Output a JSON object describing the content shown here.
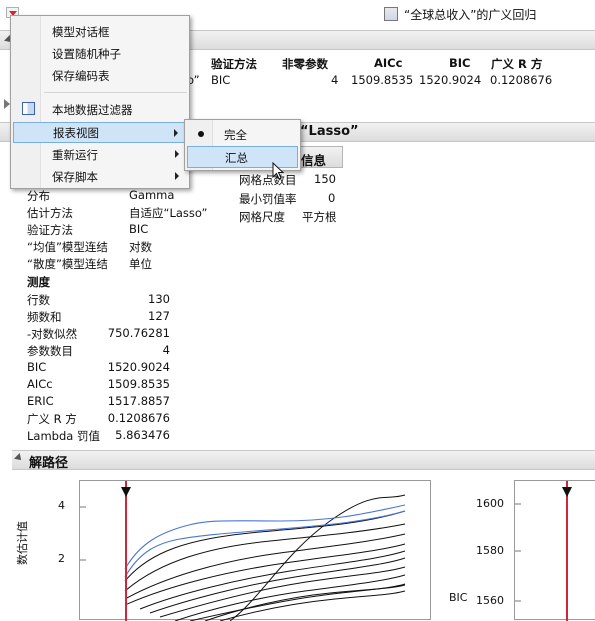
{
  "window": {
    "title": "“全球总收入”的广义回归"
  },
  "summary_table": {
    "headers": [
      "验证方法",
      "非零参数",
      "AICc",
      "BIC",
      "广义 R 方"
    ],
    "partial_cell": "o”",
    "row": [
      "BIC",
      "4",
      "1509.8535",
      "1520.9024",
      "0.1208676"
    ]
  },
  "sections": {
    "lasso_title": "“Lasso”",
    "info_label": "信息",
    "path_title": "解路径"
  },
  "model_info_left": [
    {
      "label": "分布",
      "value": "Gamma"
    },
    {
      "label": "估计方法",
      "value": "自适应“Lasso”"
    },
    {
      "label": "验证方法",
      "value": "BIC"
    },
    {
      "label": "“均值”模型连结",
      "value": "对数"
    },
    {
      "label": "“散度”模型连结",
      "value": "单位"
    }
  ],
  "model_info_right": [
    {
      "label": "网格点数目",
      "value": "150"
    },
    {
      "label": "最小罚值率",
      "value": "0"
    },
    {
      "label": "网格尺度",
      "value": "平方根"
    }
  ],
  "measures": {
    "title": "测度",
    "rows": [
      {
        "label": "行数",
        "value": "130"
      },
      {
        "label": "频数和",
        "value": "127"
      },
      {
        "label": "-对数似然",
        "value": "750.76281"
      },
      {
        "label": "参数数目",
        "value": "4"
      },
      {
        "label": "BIC",
        "value": "1520.9024"
      },
      {
        "label": "AICc",
        "value": "1509.8535"
      },
      {
        "label": "ERIC",
        "value": "1517.8857"
      },
      {
        "label": "广义 R 方",
        "value": "0.1208676"
      },
      {
        "label": "Lambda 罚值",
        "value": "5.863476"
      }
    ]
  },
  "menu": {
    "items": [
      {
        "label": "模型对话框"
      },
      {
        "label": "设置随机种子"
      },
      {
        "label": "保存编码表"
      },
      {
        "label": "本地数据过滤器"
      },
      {
        "label": "报表视图"
      },
      {
        "label": "重新运行"
      },
      {
        "label": "保存脚本"
      }
    ],
    "submenu": [
      {
        "label": "完全",
        "checked": true
      },
      {
        "label": "汇总",
        "highlighted": true
      }
    ]
  },
  "path_plot": {
    "y_ticks": [
      "4",
      "2"
    ],
    "y_label": "数估计值"
  },
  "bic_plot": {
    "y_ticks": [
      "1600",
      "1580",
      "1560"
    ],
    "y_label": "BIC"
  },
  "colors": {
    "selected_line": "#d0253a",
    "highlight_series": "#4a74d8",
    "menu_highlight": "#cfe4f7"
  }
}
